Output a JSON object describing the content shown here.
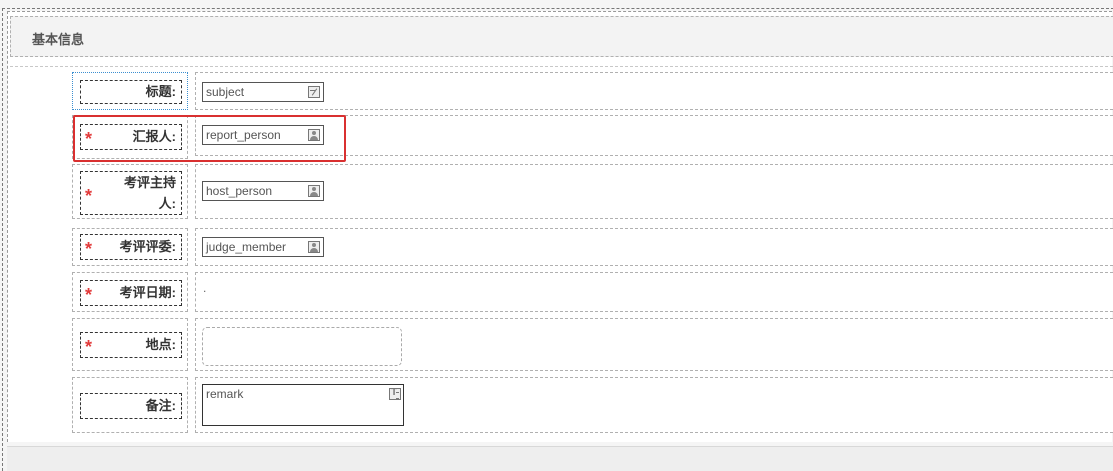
{
  "section": {
    "title": "基本信息"
  },
  "fields": [
    {
      "label": "标题:",
      "required": false,
      "value": "subject",
      "icon": "edit-icon"
    },
    {
      "label": "汇报人:",
      "required": true,
      "value": "report_person",
      "icon": "person-icon"
    },
    {
      "label": "考评主持人:",
      "label_line1": "考评主持",
      "label_line2": "人:",
      "required": true,
      "value": "host_person",
      "icon": "person-icon"
    },
    {
      "label": "考评评委:",
      "required": true,
      "value": "judge_member",
      "icon": "person-icon"
    },
    {
      "label": "考评日期:",
      "required": true,
      "value": "."
    },
    {
      "label": "地点:",
      "required": true,
      "value": ""
    },
    {
      "label": "备注:",
      "required": false,
      "value": "remark",
      "icon": "text-icon"
    }
  ],
  "required_mark": "*",
  "highlight_color": "#d93030",
  "focus_color": "#3b8fd0"
}
